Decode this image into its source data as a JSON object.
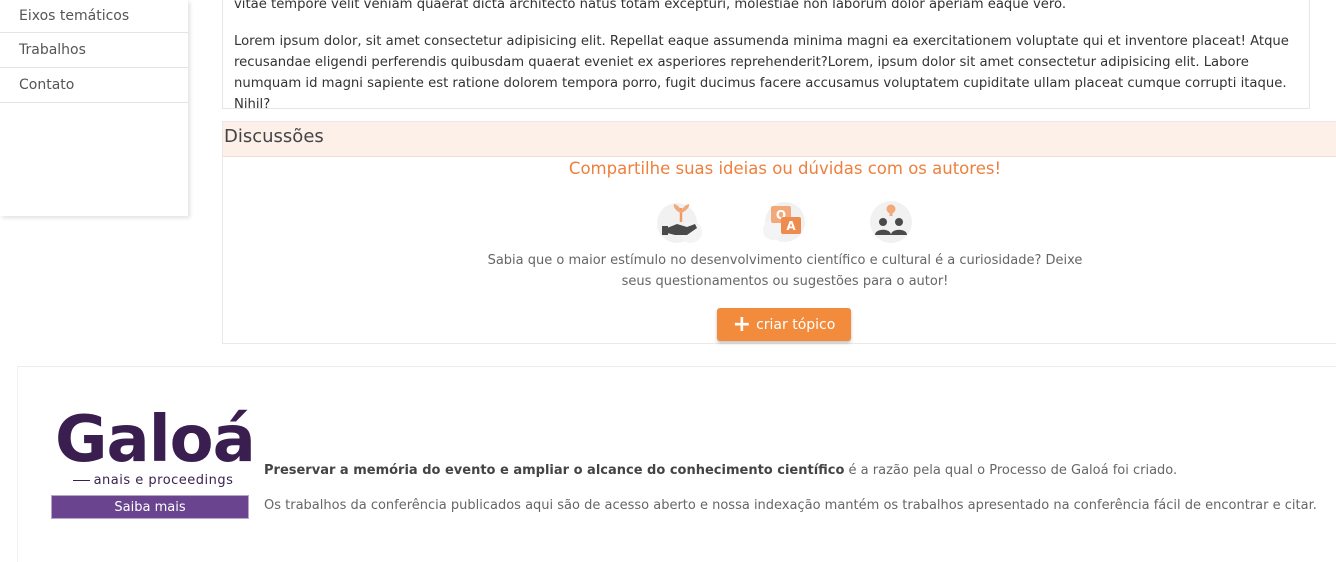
{
  "sidebar": {
    "items": [
      {
        "label": "Eixos temáticos"
      },
      {
        "label": "Trabalhos"
      },
      {
        "label": "Contato"
      }
    ]
  },
  "article": {
    "paragraph_1": "vitae tempore velit veniam quaerat dicta architecto natus totam excepturi, molestiae non laborum dolor aperiam eaque vero.",
    "paragraph_2": "Lorem ipsum dolor, sit amet consectetur adipisicing elit. Repellat eaque assumenda minima magni ea exercitationem voluptate qui et inventore placeat! Atque recusandae eligendi perferendis quibusdam quaerat eveniet ex asperiores reprehenderit?Lorem, ipsum dolor sit amet consectetur adipisicing elit. Labore numquam id magni sapiente est ratione dolorem tempora porro, fugit ducimus facere accusamus voluptatem cupiditate ullam placeat cumque corrupti itaque. Nihil?"
  },
  "discussions": {
    "title": "Discussões",
    "invite": "Compartilhe suas ideias ou dúvidas com os autores!",
    "icons": [
      "hand-plant-icon",
      "q-and-a-icon",
      "people-idea-icon"
    ],
    "description": "Sabia que o maior estímulo no desenvolvimento científico e cultural é a curiosidade? Deixe seus questionamentos ou sugestões para o autor!",
    "create_button": "criar tópico",
    "accent_color": "#f28c3c"
  },
  "footer": {
    "logo_word": "Galoá",
    "logo_subtitle": "anais e proceedings",
    "saiba_button": "Saiba mais",
    "text_1_bold": "Preservar a memória do evento e ampliar o alcance do conhecimento científico",
    "text_1_rest": " é a razão pela qual o Processo de Galoá foi criado.",
    "text_2": "Os trabalhos da conferência publicados aqui são de acesso aberto e nossa indexação mantém os trabalhos apresentado na conferência fácil de encontrar e citar.",
    "brand_color": "#3a1e4f",
    "button_color": "#6b4490"
  }
}
